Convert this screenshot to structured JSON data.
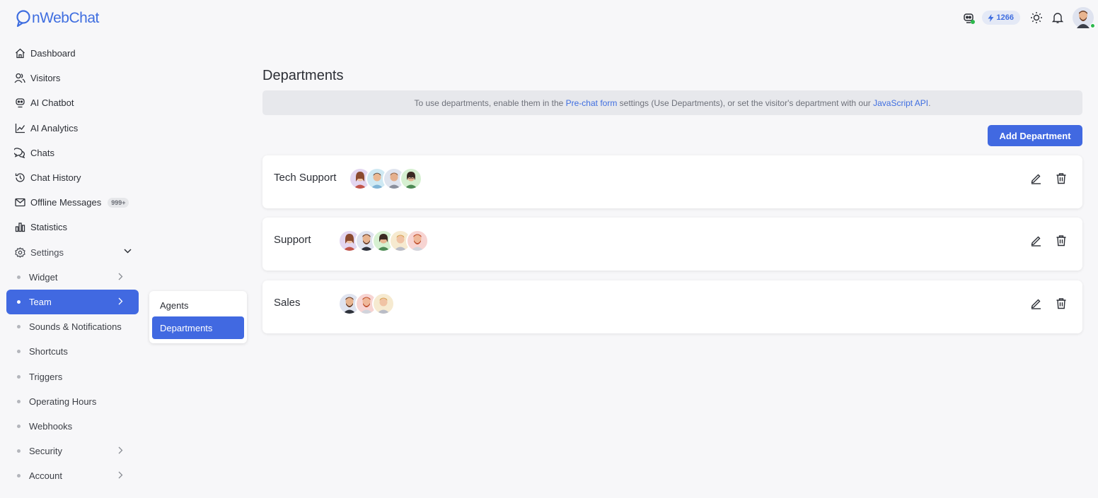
{
  "brand": {
    "logo_text": "nWebChat",
    "logo_color": "#3f6ee0"
  },
  "topbar": {
    "credits": "1266",
    "status_color": "#2db84d"
  },
  "sidebar": {
    "items": [
      {
        "label": "Dashboard",
        "icon": "home-icon"
      },
      {
        "label": "Visitors",
        "icon": "users-icon"
      },
      {
        "label": "AI Chatbot",
        "icon": "robot-icon"
      },
      {
        "label": "AI Analytics",
        "icon": "chart-line-icon"
      },
      {
        "label": "Chats",
        "icon": "chat-bubbles-icon"
      },
      {
        "label": "Chat History",
        "icon": "history-icon"
      },
      {
        "label": "Offline Messages",
        "icon": "mail-icon",
        "badge": "999+"
      },
      {
        "label": "Statistics",
        "icon": "bar-chart-icon"
      },
      {
        "label": "Settings",
        "icon": "gear-icon"
      }
    ],
    "settings_sub": [
      {
        "label": "Widget"
      },
      {
        "label": "Team"
      },
      {
        "label": "Sounds & Notifications"
      },
      {
        "label": "Shortcuts"
      },
      {
        "label": "Triggers"
      },
      {
        "label": "Operating Hours"
      },
      {
        "label": "Webhooks"
      },
      {
        "label": "Security"
      },
      {
        "label": "Account"
      }
    ],
    "active_color": "#4169e1"
  },
  "flyout": {
    "items": [
      {
        "label": "Agents"
      },
      {
        "label": "Departments"
      }
    ]
  },
  "main": {
    "title": "Departments",
    "info": {
      "part1": "To use departments, enable them in the ",
      "link1": "Pre-chat form",
      "part2": " settings (Use Departments), or set the visitor's department with our ",
      "link2": "JavaScript API",
      "part3": "."
    },
    "add_button": "Add Department",
    "departments": [
      {
        "name": "Tech Support",
        "members": 4
      },
      {
        "name": "Support",
        "members": 5
      },
      {
        "name": "Sales",
        "members": 3
      }
    ]
  }
}
